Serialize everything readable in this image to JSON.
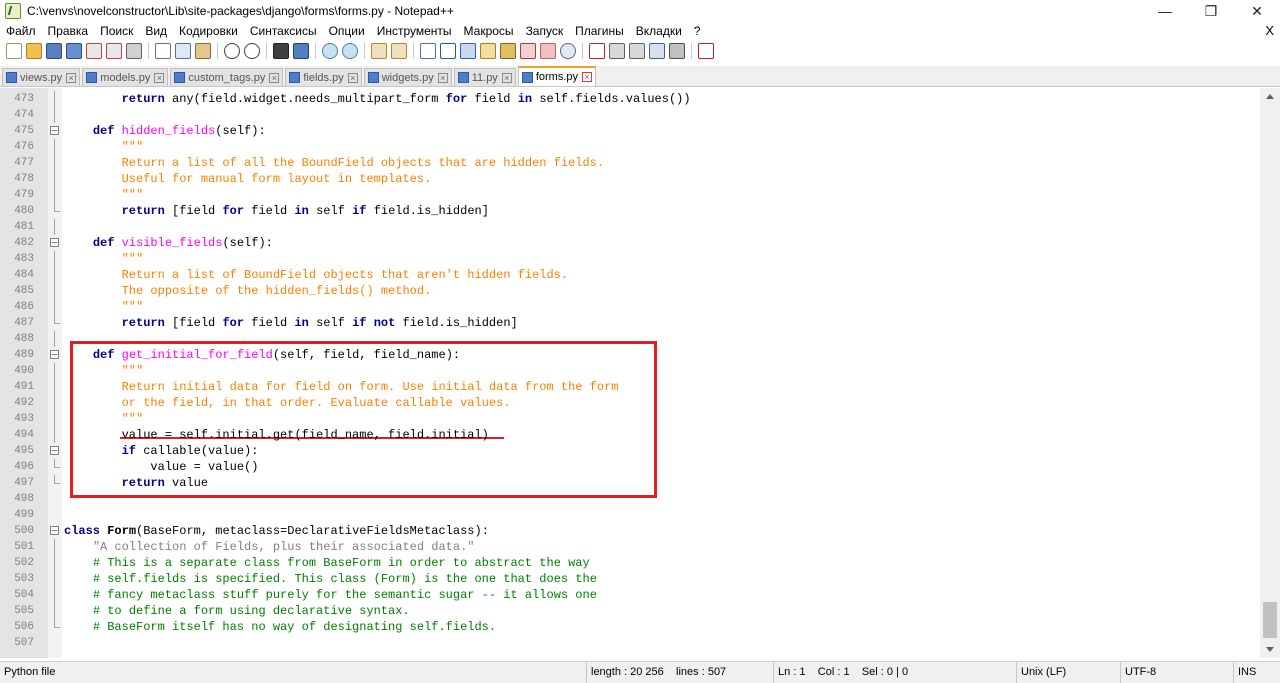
{
  "window": {
    "title": "C:\\venvs\\novelconstructor\\Lib\\site-packages\\django\\forms\\forms.py - Notepad++",
    "minimize": "—",
    "maximize": "❐",
    "close": "✕"
  },
  "menu": {
    "items": [
      "Файл",
      "Правка",
      "Поиск",
      "Вид",
      "Кодировки",
      "Синтаксисы",
      "Опции",
      "Инструменты",
      "Макросы",
      "Запуск",
      "Плагины",
      "Вкладки",
      "?"
    ],
    "close": "X"
  },
  "tabs": [
    {
      "label": "views.py",
      "active": false
    },
    {
      "label": "models.py",
      "active": false
    },
    {
      "label": "custom_tags.py",
      "active": false
    },
    {
      "label": "fields.py",
      "active": false
    },
    {
      "label": "widgets.py",
      "active": false
    },
    {
      "label": "11.py",
      "active": false
    },
    {
      "label": "forms.py",
      "active": true
    }
  ],
  "lines": [
    {
      "n": "473",
      "fold": "line",
      "parts": [
        [
          "",
          "        "
        ],
        [
          "kw",
          "return"
        ],
        [
          "",
          " any(field.widget.needs_multipart_form "
        ],
        [
          "kw",
          "for"
        ],
        [
          "",
          " field "
        ],
        [
          "kw",
          "in"
        ],
        [
          "",
          " self.fields.values())"
        ]
      ]
    },
    {
      "n": "474",
      "fold": "line",
      "parts": []
    },
    {
      "n": "475",
      "fold": "box",
      "parts": [
        [
          "",
          "    "
        ],
        [
          "kw",
          "def"
        ],
        [
          "",
          " "
        ],
        [
          "fn",
          "hidden_fields"
        ],
        [
          "",
          "(self):"
        ]
      ]
    },
    {
      "n": "476",
      "fold": "line",
      "parts": [
        [
          "",
          "        "
        ],
        [
          "str",
          "\"\"\""
        ]
      ]
    },
    {
      "n": "477",
      "fold": "line",
      "parts": [
        [
          "",
          "        "
        ],
        [
          "str",
          "Return a list of all the BoundField objects that are hidden fields."
        ]
      ]
    },
    {
      "n": "478",
      "fold": "line",
      "parts": [
        [
          "",
          "        "
        ],
        [
          "str",
          "Useful for manual form layout in templates."
        ]
      ]
    },
    {
      "n": "479",
      "fold": "line",
      "parts": [
        [
          "",
          "        "
        ],
        [
          "str",
          "\"\"\""
        ]
      ]
    },
    {
      "n": "480",
      "fold": "end",
      "parts": [
        [
          "",
          "        "
        ],
        [
          "kw",
          "return"
        ],
        [
          "",
          " [field "
        ],
        [
          "kw",
          "for"
        ],
        [
          "",
          " field "
        ],
        [
          "kw",
          "in"
        ],
        [
          "",
          " self "
        ],
        [
          "kw",
          "if"
        ],
        [
          "",
          " field.is_hidden]"
        ]
      ]
    },
    {
      "n": "481",
      "fold": "line",
      "parts": []
    },
    {
      "n": "482",
      "fold": "box",
      "parts": [
        [
          "",
          "    "
        ],
        [
          "kw",
          "def"
        ],
        [
          "",
          " "
        ],
        [
          "fn",
          "visible_fields"
        ],
        [
          "",
          "(self):"
        ]
      ]
    },
    {
      "n": "483",
      "fold": "line",
      "parts": [
        [
          "",
          "        "
        ],
        [
          "str",
          "\"\"\""
        ]
      ]
    },
    {
      "n": "484",
      "fold": "line",
      "parts": [
        [
          "",
          "        "
        ],
        [
          "str",
          "Return a list of BoundField objects that aren't hidden fields."
        ]
      ]
    },
    {
      "n": "485",
      "fold": "line",
      "parts": [
        [
          "",
          "        "
        ],
        [
          "str",
          "The opposite of the hidden_fields() method."
        ]
      ]
    },
    {
      "n": "486",
      "fold": "line",
      "parts": [
        [
          "",
          "        "
        ],
        [
          "str",
          "\"\"\""
        ]
      ]
    },
    {
      "n": "487",
      "fold": "end",
      "parts": [
        [
          "",
          "        "
        ],
        [
          "kw",
          "return"
        ],
        [
          "",
          " [field "
        ],
        [
          "kw",
          "for"
        ],
        [
          "",
          " field "
        ],
        [
          "kw",
          "in"
        ],
        [
          "",
          " self "
        ],
        [
          "kw",
          "if"
        ],
        [
          "",
          " "
        ],
        [
          "kw",
          "not"
        ],
        [
          "",
          " field.is_hidden]"
        ]
      ]
    },
    {
      "n": "488",
      "fold": "line",
      "parts": []
    },
    {
      "n": "489",
      "fold": "box",
      "parts": [
        [
          "",
          "    "
        ],
        [
          "kw",
          "def"
        ],
        [
          "",
          " "
        ],
        [
          "fn",
          "get_initial_for_field"
        ],
        [
          "",
          "(self, field, field_name):"
        ]
      ]
    },
    {
      "n": "490",
      "fold": "line",
      "parts": [
        [
          "",
          "        "
        ],
        [
          "str",
          "\"\"\""
        ]
      ]
    },
    {
      "n": "491",
      "fold": "line",
      "parts": [
        [
          "",
          "        "
        ],
        [
          "str",
          "Return initial data for field on form. Use initial data from the form"
        ]
      ]
    },
    {
      "n": "492",
      "fold": "line",
      "parts": [
        [
          "",
          "        "
        ],
        [
          "str",
          "or the field, in that order. Evaluate callable values."
        ]
      ]
    },
    {
      "n": "493",
      "fold": "line",
      "parts": [
        [
          "",
          "        "
        ],
        [
          "str",
          "\"\"\""
        ]
      ]
    },
    {
      "n": "494",
      "fold": "line",
      "parts": [
        [
          "",
          "        value = self.initial.get(field_name, field.initial)"
        ]
      ]
    },
    {
      "n": "495",
      "fold": "box",
      "parts": [
        [
          "",
          "        "
        ],
        [
          "kw",
          "if"
        ],
        [
          "",
          " callable(value):"
        ]
      ]
    },
    {
      "n": "496",
      "fold": "end",
      "parts": [
        [
          "",
          "            value = value()"
        ]
      ]
    },
    {
      "n": "497",
      "fold": "end",
      "parts": [
        [
          "",
          "        "
        ],
        [
          "kw",
          "return"
        ],
        [
          "",
          " value"
        ]
      ]
    },
    {
      "n": "498",
      "fold": "none",
      "parts": []
    },
    {
      "n": "499",
      "fold": "none",
      "parts": []
    },
    {
      "n": "500",
      "fold": "box",
      "parts": [
        [
          "kw",
          "class"
        ],
        [
          "",
          " "
        ],
        [
          "cls",
          "Form"
        ],
        [
          "",
          "(BaseForm, metaclass=DeclarativeFieldsMetaclass):"
        ]
      ]
    },
    {
      "n": "501",
      "fold": "line",
      "parts": [
        [
          "",
          "    "
        ],
        [
          "dstr",
          "\"A collection of Fields, plus their associated data.\""
        ]
      ]
    },
    {
      "n": "502",
      "fold": "line",
      "parts": [
        [
          "",
          "    "
        ],
        [
          "cmt",
          "# This is a separate class from BaseForm in order to abstract the way"
        ]
      ]
    },
    {
      "n": "503",
      "fold": "line",
      "parts": [
        [
          "",
          "    "
        ],
        [
          "cmt",
          "# self.fields is specified. This class (Form) is the one that does the"
        ]
      ]
    },
    {
      "n": "504",
      "fold": "line",
      "parts": [
        [
          "",
          "    "
        ],
        [
          "cmt",
          "# fancy metaclass stuff purely for the semantic sugar -- it allows one"
        ]
      ]
    },
    {
      "n": "505",
      "fold": "line",
      "parts": [
        [
          "",
          "    "
        ],
        [
          "cmt",
          "# to define a form using declarative syntax."
        ]
      ]
    },
    {
      "n": "506",
      "fold": "end",
      "parts": [
        [
          "",
          "    "
        ],
        [
          "cmt",
          "# BaseForm itself has no way of designating self.fields."
        ]
      ]
    },
    {
      "n": "507",
      "fold": "none",
      "parts": []
    }
  ],
  "status": {
    "filetype": "Python file",
    "length": "length : 20 256",
    "lines": "lines : 507",
    "ln": "Ln : 1",
    "col": "Col : 1",
    "sel": "Sel : 0 | 0",
    "eol": "Unix (LF)",
    "encoding": "UTF-8",
    "mode": "INS"
  },
  "colors": {
    "keyword": "#00008b",
    "function": "#ff00ff",
    "docstring": "#ff8000",
    "comment": "#008000",
    "highlight": "#e02020"
  }
}
